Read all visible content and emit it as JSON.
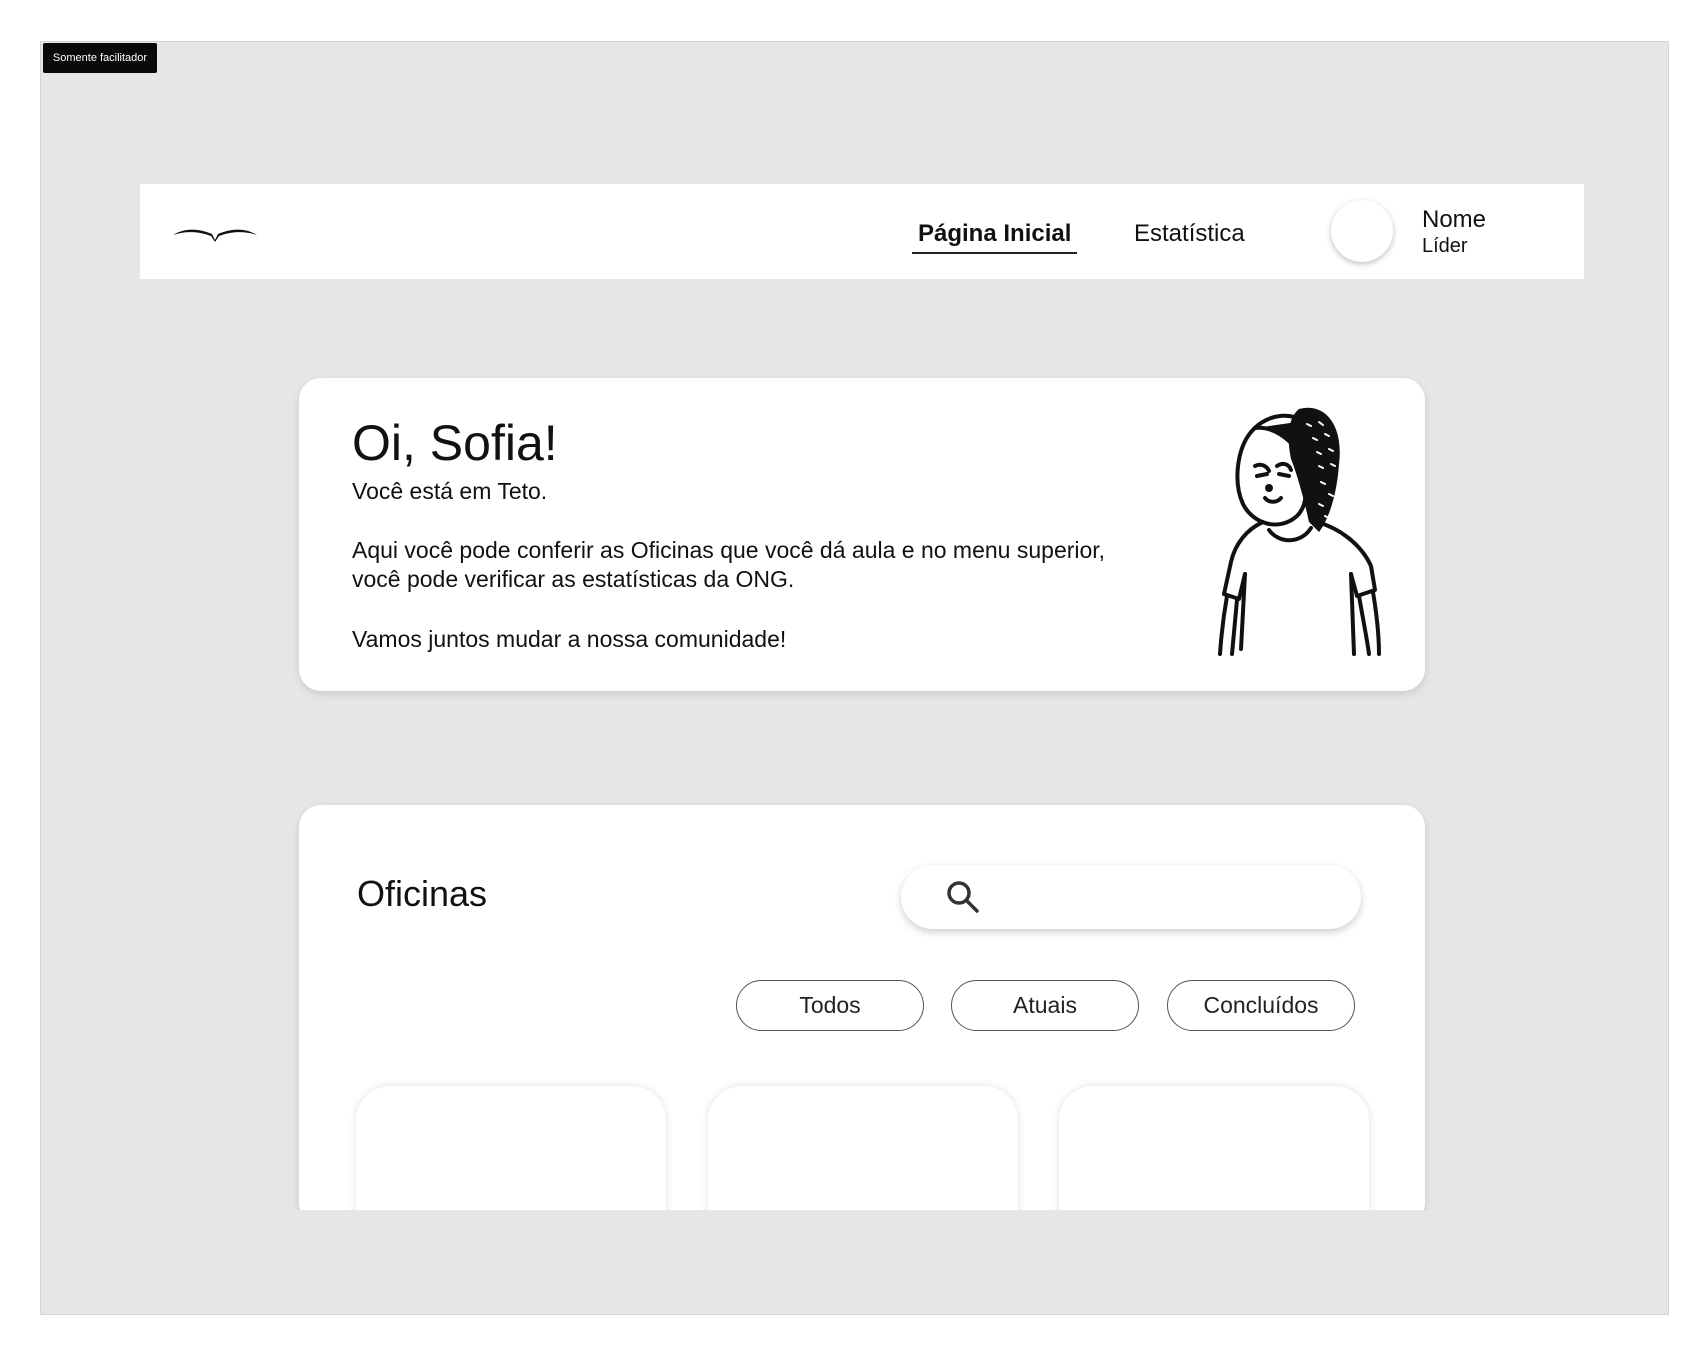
{
  "frame": {
    "tag": "Somente facilitador"
  },
  "navbar": {
    "logo_icon": "bird-logo-icon",
    "items": [
      {
        "label": "Página Inicial",
        "active": true
      },
      {
        "label": "Estatística",
        "active": false
      }
    ],
    "user": {
      "name": "Nome",
      "role": "Líder"
    }
  },
  "welcome": {
    "greeting": "Oi, Sofia!",
    "subtitle": "Você está em Teto.",
    "body": "Aqui você pode conferir as Oficinas que você dá aula e no menu superior, você pode verificar as estatísticas da ONG.",
    "cta": "Vamos juntos mudar a nossa comunidade!",
    "illustration_icon": "girl-illustration-icon"
  },
  "workshops": {
    "title": "Oficinas",
    "search": {
      "placeholder": "",
      "value": "",
      "icon": "search-icon"
    },
    "filters": [
      "Todos",
      "Atuais",
      "Concluídos"
    ],
    "tiles": [
      {},
      {},
      {}
    ]
  }
}
